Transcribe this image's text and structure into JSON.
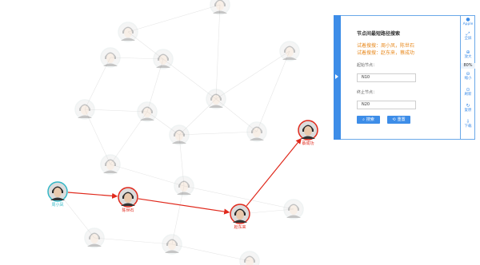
{
  "panel": {
    "title": "节点间最短路径搜索",
    "hint1": "试着搜搜：周小凤，陈世石",
    "hint2": "试着搜搜：赵东来，蔡成功",
    "start_label": "起始节点：",
    "start_value": "N10",
    "end_label": "终止节点：",
    "end_value": "N20",
    "search_label": "搜索",
    "reset_label": "重置"
  },
  "toolbar": {
    "apple_label": "Apple",
    "fullscreen_label": "全屏",
    "zoom_in_label": "放大",
    "zoom_value": "80%",
    "zoom_out_label": "缩小",
    "refresh_label": "刷新",
    "reset_label": "复原",
    "download_label": "下载"
  },
  "graph": {
    "nodes": [
      {
        "id": "n_top",
        "label": "",
        "state": "faded"
      },
      {
        "id": "n1",
        "label": "",
        "state": "faded"
      },
      {
        "id": "n2",
        "label": "",
        "state": "faded"
      },
      {
        "id": "n3",
        "label": "",
        "state": "faded"
      },
      {
        "id": "n4",
        "label": "",
        "state": "faded"
      },
      {
        "id": "n5",
        "label": "",
        "state": "faded"
      },
      {
        "id": "n6",
        "label": "",
        "state": "faded"
      },
      {
        "id": "n7",
        "label": "",
        "state": "faded"
      },
      {
        "id": "n8",
        "label": "",
        "state": "faded"
      },
      {
        "id": "n9",
        "label": "",
        "state": "faded"
      },
      {
        "id": "n10",
        "label": "",
        "state": "faded"
      },
      {
        "id": "n11",
        "label": "",
        "state": "faded"
      },
      {
        "id": "n12",
        "label": "",
        "state": "faded"
      },
      {
        "id": "n13",
        "label": "",
        "state": "faded"
      },
      {
        "id": "n14",
        "label": "",
        "state": "faded"
      },
      {
        "id": "n15",
        "label": "",
        "state": "faded"
      },
      {
        "id": "p_start",
        "label": "周小凤",
        "state": "start"
      },
      {
        "id": "p_a",
        "label": "陈世石",
        "state": "path"
      },
      {
        "id": "p_b",
        "label": "赵东来",
        "state": "path"
      },
      {
        "id": "p_end",
        "label": "蔡成功",
        "state": "path"
      }
    ],
    "path_color": "#e0291c",
    "start_color": "#35b8c7",
    "path_node_color": "#e0291c"
  }
}
